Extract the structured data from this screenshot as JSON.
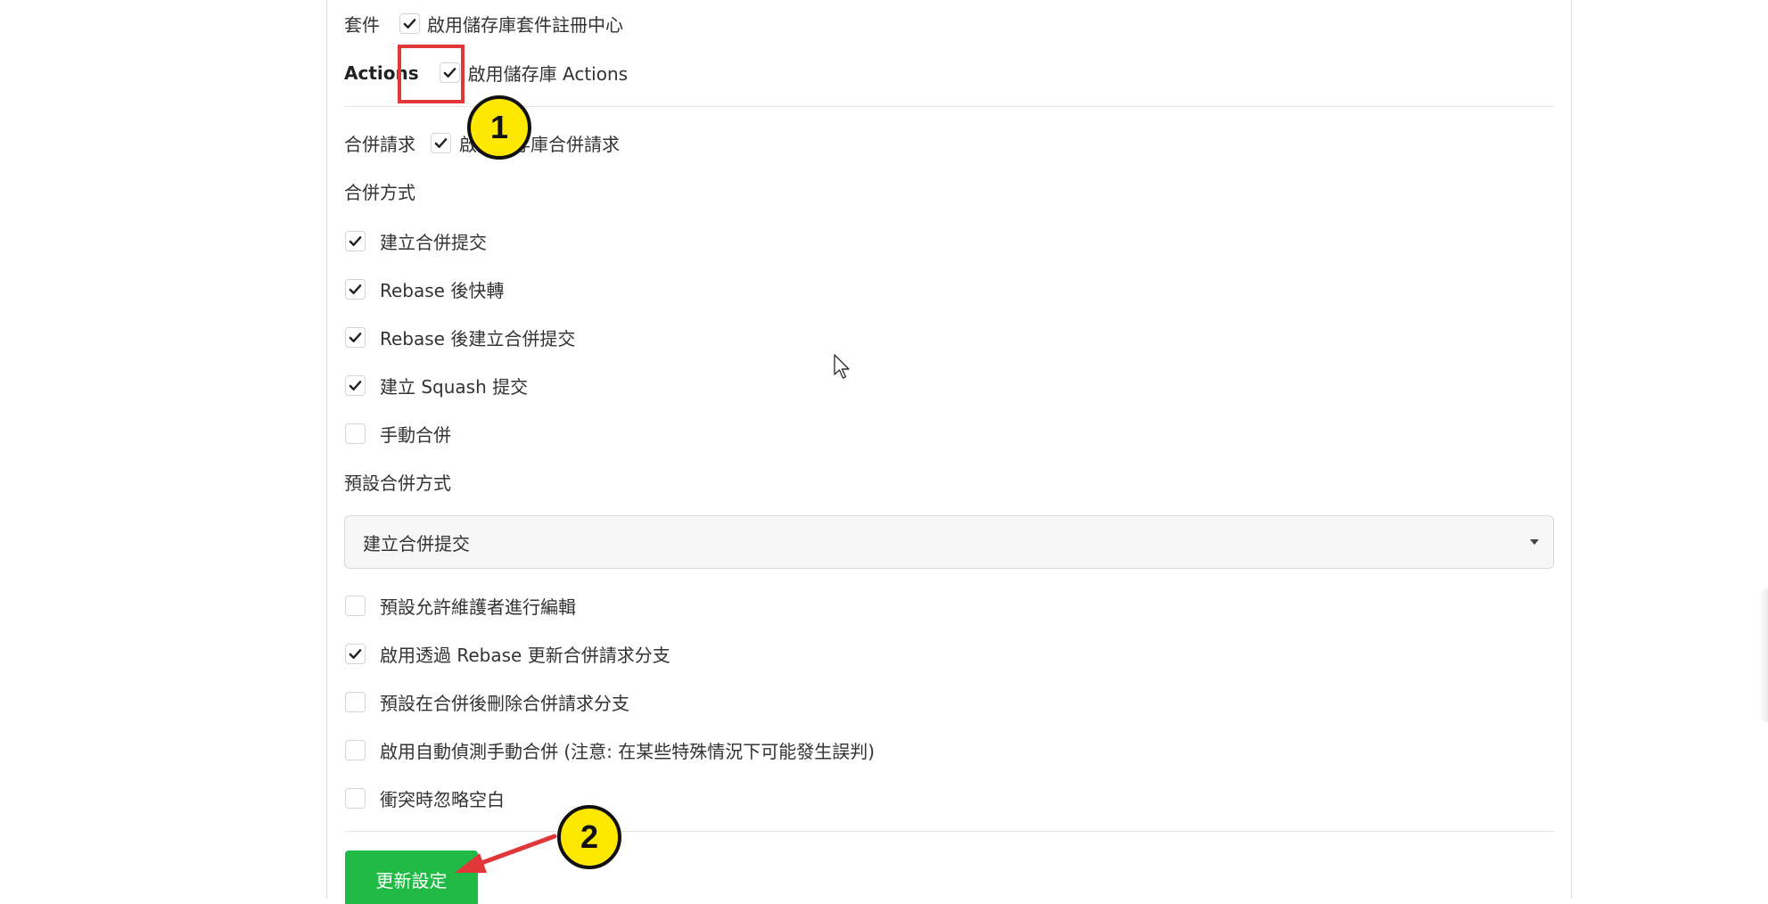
{
  "settings": {
    "packages": {
      "section_label": "套件",
      "checkbox_label": "啟用儲存庫套件註冊中心",
      "checked": true
    },
    "actions": {
      "section_label": "Actions",
      "checkbox_label": "啟用儲存庫 Actions",
      "checked": true
    },
    "pull_requests": {
      "section_label": "合併請求",
      "checkbox_label": "啟用儲存庫合併請求",
      "checked": true
    },
    "merge_styles": {
      "heading": "合併方式",
      "options": [
        {
          "label": "建立合併提交",
          "checked": true
        },
        {
          "label": "Rebase 後快轉",
          "checked": true
        },
        {
          "label": "Rebase 後建立合併提交",
          "checked": true
        },
        {
          "label": "建立 Squash 提交",
          "checked": true
        },
        {
          "label": "手動合併",
          "checked": false
        }
      ]
    },
    "default_merge_style": {
      "heading": "預設合併方式",
      "selected": "建立合併提交"
    },
    "extra_options": [
      {
        "label": "預設允許維護者進行編輯",
        "checked": false
      },
      {
        "label": "啟用透過 Rebase 更新合併請求分支",
        "checked": true
      },
      {
        "label": "預設在合併後刪除合併請求分支",
        "checked": false
      },
      {
        "label": "啟用自動偵測手動合併 (注意: 在某些特殊情況下可能發生誤判)",
        "checked": false
      },
      {
        "label": "衝突時忽略空白",
        "checked": false
      }
    ],
    "update_button": "更新設定"
  },
  "annotations": {
    "marker_1": "1",
    "marker_2": "2",
    "highlight_color": "#e0383a",
    "marker_color": "#ffe800"
  },
  "colors": {
    "primary_button": "#21ba45"
  }
}
